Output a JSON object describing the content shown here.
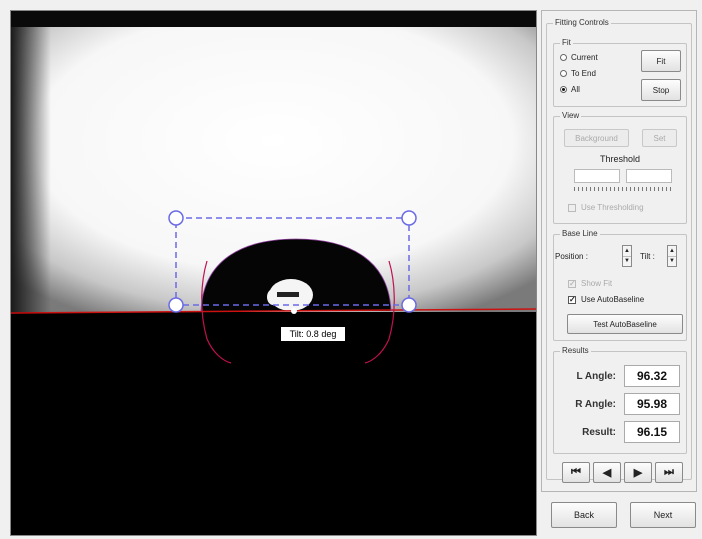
{
  "viewer": {
    "tilt_label": "Tilt: 0.8 deg"
  },
  "panel": {
    "title": "Fitting Controls",
    "fit": {
      "title": "Fit",
      "options": [
        "Current",
        "To End",
        "All"
      ],
      "selected": "All",
      "fit_button": "Fit",
      "stop_button": "Stop"
    },
    "view": {
      "title": "View",
      "left_button": "Background",
      "right_button": "Set",
      "threshold_label": "Threshold",
      "use_threshold_label": "Use Thresholding",
      "use_threshold_checked": false
    },
    "baseline": {
      "title": "Base Line",
      "position_label": "Position",
      "tilt_label": "Tilt",
      "show_fit_label": "Show Fit",
      "show_fit_checked": true,
      "auto_label": "Use AutoBaseline",
      "auto_checked": true,
      "test_button": "Test AutoBaseline"
    },
    "results": {
      "title": "Results",
      "l_label": "L Angle:",
      "l_value": "96.32",
      "r_label": "R Angle:",
      "r_value": "95.98",
      "res_label": "Result:",
      "res_value": "96.15"
    },
    "nav": {
      "first": "⏮",
      "prev": "◀",
      "next": "▶",
      "last": "⏭"
    }
  },
  "footer": {
    "back_button": "Back",
    "next_button": "Next"
  },
  "colors": {
    "handle": "#6a6ae6",
    "fit_curve": "#c01050",
    "baseline": "#cc1111"
  }
}
